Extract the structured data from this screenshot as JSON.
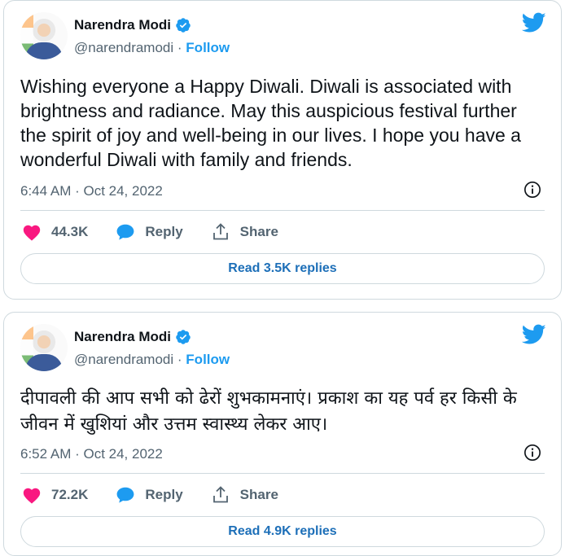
{
  "colors": {
    "accent": "#1d9bf0",
    "heart": "#f91880",
    "border": "#cfd9de",
    "muted": "#536471"
  },
  "tweets": [
    {
      "name": "Narendra Modi",
      "handle": "@narendramodi",
      "separator": "·",
      "follow": "Follow",
      "text": "Wishing everyone a Happy Diwali. Diwali is associated with brightness and radiance. May this auspicious festival further the spirit of joy and well-being in our lives. I hope you have a wonderful Diwali with family and friends.",
      "time": "6:44 AM · Oct 24, 2022",
      "likes": "44.3K",
      "reply": "Reply",
      "share": "Share",
      "read_replies": "Read 3.5K replies"
    },
    {
      "name": "Narendra Modi",
      "handle": "@narendramodi",
      "separator": "·",
      "follow": "Follow",
      "text": "दीपावली की आप सभी को ढेरों शुभकामनाएं। प्रकाश का यह पर्व हर किसी के जीवन में खुशियां और उत्तम स्वास्थ्य लेकर आए।",
      "time": "6:52 AM · Oct 24, 2022",
      "likes": "72.2K",
      "reply": "Reply",
      "share": "Share",
      "read_replies": "Read 4.9K replies"
    }
  ],
  "icons": [
    "verified-badge-icon",
    "twitter-bird-icon",
    "info-icon",
    "heart-icon",
    "reply-bubble-icon",
    "share-icon"
  ]
}
